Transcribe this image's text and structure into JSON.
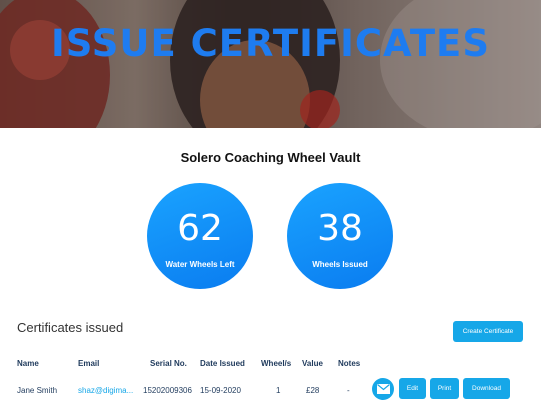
{
  "hero": {
    "title": "ISSUE CERTIFICATES"
  },
  "vault": {
    "title": "Solero Coaching Wheel Vault"
  },
  "stats": [
    {
      "value": "62",
      "label": "Water Wheels Left"
    },
    {
      "value": "38",
      "label": "Wheels Issued"
    }
  ],
  "certificates": {
    "title": "Certificates issued",
    "create_label": "Create Certificate",
    "columns": [
      "Name",
      "Email",
      "Serial No.",
      "Date Issued",
      "Wheel/s",
      "Value",
      "Notes"
    ],
    "rows": [
      {
        "name": "Jane Smith",
        "email": "shaz@digima...",
        "serial": "15202009306",
        "date": "15-09-2020",
        "wheels": "1",
        "value": "£28",
        "notes": "-"
      }
    ],
    "actions": {
      "email_icon": "mail-icon",
      "edit": "Edit",
      "print": "Print",
      "download": "Download"
    }
  },
  "colors": {
    "accent": "#16a7e8",
    "hero_title": "#1e7cf0",
    "stat_circle": "#0a7cf0"
  }
}
